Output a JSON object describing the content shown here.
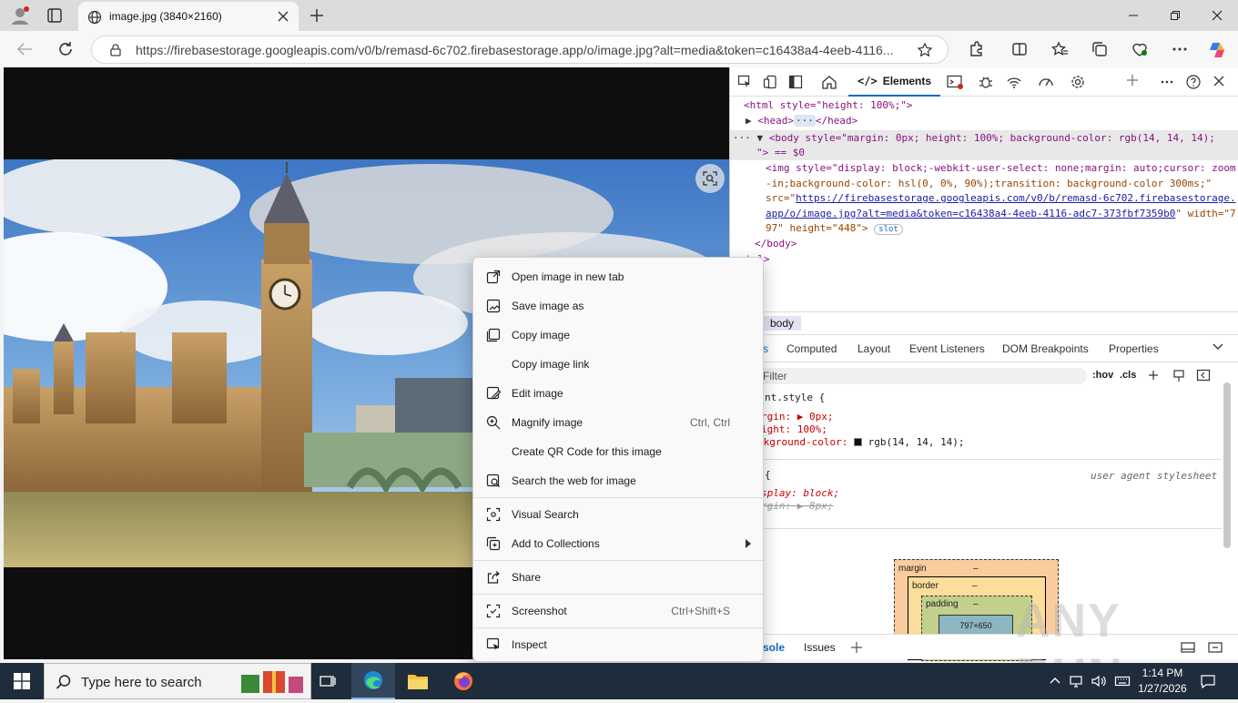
{
  "tab": {
    "title": "image.jpg (3840×2160)"
  },
  "address": {
    "url": "https://firebasestorage.googleapis.com/v0/b/remasd-6c702.firebasestorage.app/o/image.jpg?alt=media&token=c16438a4-4eeb-4116..."
  },
  "devtools": {
    "elements_tab": "Elements",
    "dom": {
      "l1": "<html style=\"height: 100%;\">",
      "l2_open": "<head>",
      "l2_close": "</head>",
      "l3": "<body style=\"margin: 0px; height: 100%; background-color: rgb(14, 14, 14);",
      "l4": "\"> == $0",
      "l5": "<img style=\"display: block;-webkit-user-select: none;margin: auto;cursor: zoom",
      "l6": "-in;background-color: hsl(0, 0%, 90%);transition: background-color 300ms;\"",
      "l7_src": "src=\"",
      "l7_link": "https://firebasestorage.googleapis.com/v0/b/remasd-6c702.firebasestorage.",
      "l8_link": "app/o/image.jpg?alt=media&token=c16438a4-4eeb-4116-adc7-373fbf7359b0",
      "l8_rest": "\" width=\"7",
      "l9": "97\" height=\"448\">",
      "slot": "slot",
      "l10": "</body>",
      "l11": "tml>"
    },
    "breadcrumb": "body",
    "styles_tabs": [
      "s",
      "Computed",
      "Layout",
      "Event Listeners",
      "DOM Breakpoints",
      "Properties"
    ],
    "filter_placeholder": "Filter",
    "hov": ":hov",
    "cls": ".cls",
    "rules": {
      "r1": "nt.style {",
      "r2": "rgin: ▶ 0px;",
      "r3": "ight: 100%;",
      "r4a": "ckground-color: ",
      "r4b": "rgb(14, 14, 14);",
      "r5": "{",
      "ua": "user agent stylesheet",
      "r6": "splay: block;",
      "r7": "rgin: ▶ 8px;"
    },
    "box": {
      "margin": "margin",
      "border": "border",
      "padding": "padding",
      "dash": "–",
      "content": "797×650"
    },
    "drawer": {
      "console": "sole",
      "issues": "Issues"
    }
  },
  "context_menu": {
    "items": [
      {
        "label": "Open image in new tab",
        "shortcut": ""
      },
      {
        "label": "Save image as",
        "shortcut": ""
      },
      {
        "label": "Copy image",
        "shortcut": ""
      },
      {
        "label": "Copy image link",
        "shortcut": ""
      },
      {
        "label": "Edit image",
        "shortcut": ""
      },
      {
        "label": "Magnify image",
        "shortcut": "Ctrl, Ctrl"
      },
      {
        "label": "Create QR Code for this image",
        "shortcut": ""
      },
      {
        "label": "Search the web for image",
        "shortcut": ""
      },
      {
        "label": "Visual Search",
        "shortcut": ""
      },
      {
        "label": "Add to Collections",
        "shortcut": ""
      },
      {
        "label": "Share",
        "shortcut": ""
      },
      {
        "label": "Screenshot",
        "shortcut": "Ctrl+Shift+S"
      },
      {
        "label": "Inspect",
        "shortcut": ""
      }
    ]
  },
  "taskbar": {
    "search_placeholder": "Type here to search",
    "time": "1:14 PM",
    "date": "1/27/2026"
  },
  "watermark": "ANY RUN",
  "colors": {
    "accent": "#0f6cbd",
    "taskbar": "#1f2c3b",
    "page_bg": "#0e0e0e"
  }
}
